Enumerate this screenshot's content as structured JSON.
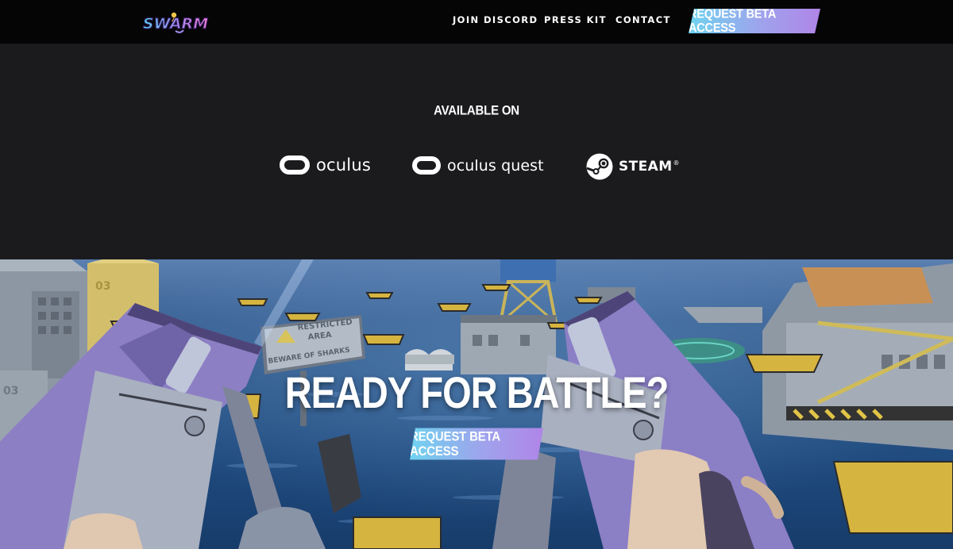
{
  "nav": {
    "logo_text": "SWARM",
    "links": [
      "JOIN DISCORD",
      "PRESS KIT",
      "CONTACT"
    ],
    "cta_label": "REQUEST BETA ACCESS"
  },
  "platforms": {
    "heading": "AVAILABLE ON",
    "items": [
      {
        "label": "oculus",
        "icon": "oculus-logo-icon"
      },
      {
        "label": "oculus quest",
        "icon": "oculus-logo-icon"
      },
      {
        "label": "STEAM",
        "mark": "®",
        "icon": "steam-logo-icon"
      }
    ]
  },
  "hero": {
    "title": "READY FOR BATTLE?",
    "cta_label": "REQUEST BETA ACCESS",
    "sign_lines": [
      "RESTRICTED",
      "AREA",
      "BEWARE OF SHARKS"
    ],
    "building_numbers": [
      "03",
      "03"
    ]
  },
  "colors": {
    "nav_bg": "#050505",
    "section_bg": "#1b1b1e",
    "cta_gradient_start": "#6fd3f0",
    "cta_gradient_end": "#b085e8",
    "text": "#ffffff",
    "ocean": "#2c5688"
  }
}
